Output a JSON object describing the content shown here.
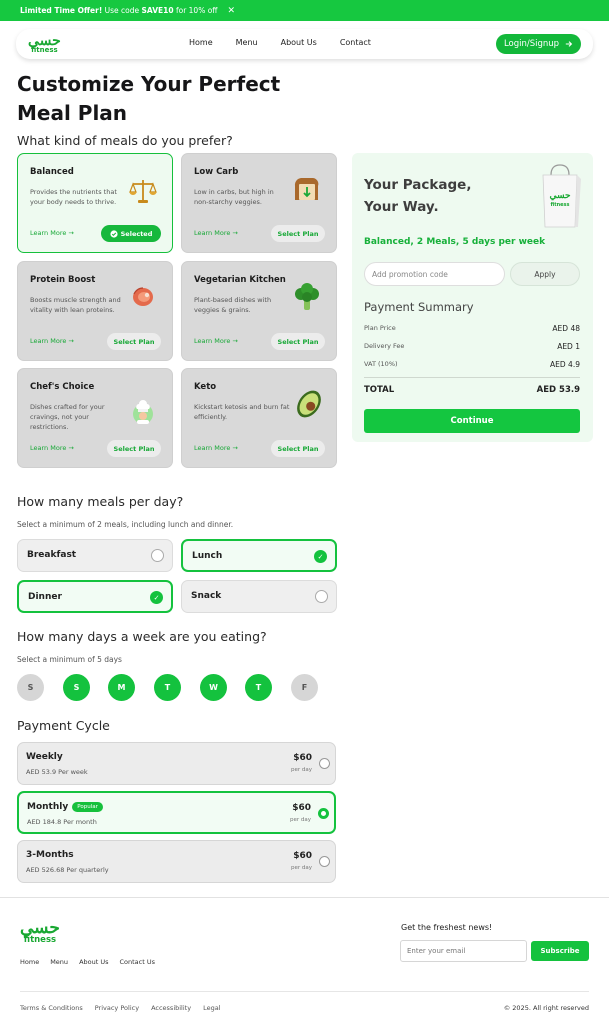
{
  "promo": {
    "bold": "Limited Time Offer!",
    "text_a": " Use code ",
    "code": "SAVE10",
    "text_b": " for 10% off",
    "close": "✕"
  },
  "brand": {
    "logo_ar": "حسي",
    "logo_en": "fitness",
    "accent": "#14c23e"
  },
  "nav": {
    "links": [
      "Home",
      "Menu",
      "About Us",
      "Contact"
    ],
    "login": "Login/Signup",
    "login_icon": "arrow-right-icon"
  },
  "page_title": "Customize Your Perfect Meal Plan",
  "meals_question": "What kind of meals do you prefer?",
  "meal_cards": [
    {
      "title": "Balanced",
      "desc": "Provides the nutrients that your body needs to thrive.",
      "learn": "Learn More →",
      "action": "Selected",
      "icon": "scale-icon",
      "selected": true
    },
    {
      "title": "Low Carb",
      "desc": "Low in carbs, but high in non-starchy veggies.",
      "learn": "Learn More →",
      "action": "Select Plan",
      "icon": "bread-icon",
      "selected": false
    },
    {
      "title": "Protein Boost",
      "desc": "Boosts muscle strength and vitality with lean proteins.",
      "learn": "Learn More →",
      "action": "Select Plan",
      "icon": "steak-icon",
      "selected": false
    },
    {
      "title": "Vegetarian Kitchen",
      "desc": "Plant-based dishes with veggies & grains.",
      "learn": "Learn More →",
      "action": "Select Plan",
      "icon": "broccoli-icon",
      "selected": false
    },
    {
      "title": "Chef's Choice",
      "desc": "Dishes crafted for your cravings, not your restrictions.",
      "learn": "Learn More →",
      "action": "Select Plan",
      "icon": "chef-icon",
      "selected": false
    },
    {
      "title": "Keto",
      "desc": "Kickstart ketosis and burn fat efficiently.",
      "learn": "Learn More →",
      "action": "Select Plan",
      "icon": "avocado-icon",
      "selected": false
    }
  ],
  "package": {
    "title": "Your Package, Your Way.",
    "summary": "Balanced, 2 Meals, 5 days per week",
    "promo_placeholder": "Add promotion code",
    "apply": "Apply",
    "payment_title": "Payment Summary",
    "rows": [
      {
        "label": "Plan Price",
        "value": "AED 48"
      },
      {
        "label": "Delivery Fee",
        "value": "AED 1"
      },
      {
        "label": "VAT (10%)",
        "value": "AED 4.9"
      }
    ],
    "total_label": "TOTAL",
    "total_value": "AED 53.9",
    "continue": "Continue"
  },
  "meals_per_day": {
    "question": "How many meals per day?",
    "hint": "Select a minimum of 2 meals, including lunch and dinner.",
    "options": [
      {
        "label": "Breakfast",
        "selected": false
      },
      {
        "label": "Lunch",
        "selected": true
      },
      {
        "label": "Dinner",
        "selected": true
      },
      {
        "label": "Snack",
        "selected": false
      }
    ]
  },
  "days": {
    "question": "How many days a week are you eating?",
    "hint": "Select a minimum of 5 days",
    "items": [
      {
        "label": "S",
        "on": false
      },
      {
        "label": "S",
        "on": true
      },
      {
        "label": "M",
        "on": true
      },
      {
        "label": "T",
        "on": true
      },
      {
        "label": "W",
        "on": true
      },
      {
        "label": "T",
        "on": true
      },
      {
        "label": "F",
        "on": false
      }
    ]
  },
  "payment_cycle": {
    "title": "Payment Cycle",
    "options": [
      {
        "name": "Weekly",
        "sub": "AED 53.9 Per week",
        "price": "$60",
        "per": "per day",
        "badge": "",
        "selected": false
      },
      {
        "name": "Monthly",
        "sub": "AED 184.8 Per month",
        "price": "$60",
        "per": "per day",
        "badge": "Popular",
        "selected": true
      },
      {
        "name": "3-Months",
        "sub": "AED 526.68 Per quarterly",
        "price": "$60",
        "per": "per day",
        "badge": "",
        "selected": false
      }
    ]
  },
  "footer": {
    "links": [
      "Home",
      "Menu",
      "About Us",
      "Contact Us"
    ],
    "news_title": "Get the freshest news!",
    "email_placeholder": "Enter your email",
    "subscribe": "Subscribe",
    "legal": [
      "Terms & Conditions",
      "Privacy Policy",
      "Accessibility",
      "Legal"
    ],
    "copyright": "© 2025. All right reserved"
  }
}
